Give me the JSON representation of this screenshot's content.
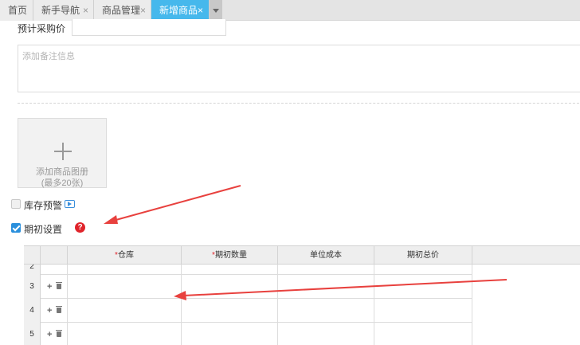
{
  "tabs": [
    {
      "label": "首页",
      "close": ""
    },
    {
      "label": "新手导航",
      "close": "×"
    },
    {
      "label": "商品管理",
      "close": "×"
    },
    {
      "label": "新增商品",
      "close": "×"
    }
  ],
  "form": {
    "purchase_price_label": "预计采购价",
    "purchase_price_value": "",
    "remark_placeholder": "添加备注信息"
  },
  "upload": {
    "line1": "添加商品图册",
    "line2": "(最多20张)"
  },
  "stock_warning": {
    "label": "库存预警",
    "checked": false
  },
  "opening_setup": {
    "label": "期初设置",
    "checked": true,
    "help_glyph": "?"
  },
  "grid": {
    "headers": {
      "warehouse": "仓库",
      "opening_qty": "期初数量",
      "unit_cost": "单位成本",
      "opening_total": "期初总价",
      "required_mark": "*"
    },
    "partial_row_num": "2",
    "rows": [
      {
        "num": "3",
        "add": "+",
        "warehouse": "",
        "qty": "",
        "cost": "",
        "total": ""
      },
      {
        "num": "4",
        "add": "+",
        "warehouse": "",
        "qty": "",
        "cost": "",
        "total": ""
      },
      {
        "num": "5",
        "add": "+",
        "warehouse": "",
        "qty": "",
        "cost": "",
        "total": ""
      }
    ]
  },
  "colors": {
    "active_tab": "#46b8ec",
    "annotation_arrow": "#e8413e",
    "checkbox_checked": "#2a8fdc",
    "help_icon": "#e0242b"
  },
  "icons": [
    "close-icon",
    "dropdown-caret-icon",
    "plus-icon",
    "video-icon",
    "help-icon",
    "add-row-icon",
    "trash-icon"
  ]
}
